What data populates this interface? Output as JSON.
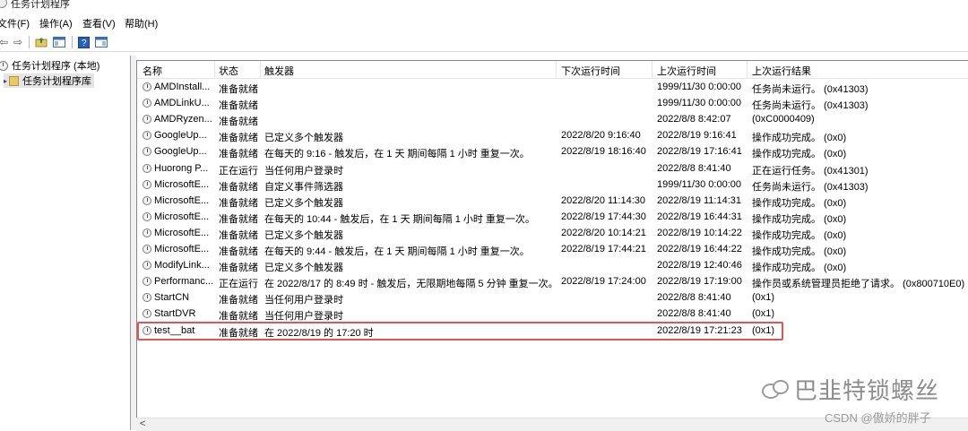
{
  "window": {
    "title": "任务计划程序"
  },
  "menu": [
    "文件(F)",
    "操作(A)",
    "查看(V)",
    "帮助(H)"
  ],
  "toolbar": {
    "buttons": [
      "back-icon",
      "forward-icon",
      "up-folder-icon",
      "show-hide-console-tree-icon",
      "help-icon",
      "show-hide-action-pane-icon"
    ]
  },
  "tree": {
    "root": "任务计划程序 (本地)",
    "library": "任务计划程序库"
  },
  "table": {
    "columns": [
      "名称",
      "状态",
      "触发器",
      "下次运行时间",
      "上次运行时间",
      "上次运行结果"
    ],
    "rows": [
      [
        "AMDInstall...",
        "准备就绪",
        "",
        "",
        "1999/11/30 0:00:00",
        "任务尚未运行。 (0x41303)"
      ],
      [
        "AMDLinkU...",
        "准备就绪",
        "",
        "",
        "1999/11/30 0:00:00",
        "任务尚未运行。 (0x41303)"
      ],
      [
        "AMDRyzen...",
        "准备就绪",
        "",
        "",
        "2022/8/8 8:42:07",
        "(0xC0000409)"
      ],
      [
        "GoogleUp...",
        "准备就绪",
        "已定义多个触发器",
        "2022/8/20 9:16:40",
        "2022/8/19 9:16:41",
        "操作成功完成。 (0x0)"
      ],
      [
        "GoogleUp...",
        "准备就绪",
        "在每天的 9:16 - 触发后，在 1 天 期间每隔 1 小时 重复一次。",
        "2022/8/19 18:16:40",
        "2022/8/19 17:16:41",
        "操作成功完成。 (0x0)"
      ],
      [
        "Huorong P...",
        "正在运行",
        "当任何用户登录时",
        "",
        "2022/8/8 8:41:40",
        "正在运行任务。 (0x41301)"
      ],
      [
        "MicrosoftE...",
        "准备就绪",
        "自定义事件筛选器",
        "",
        "1999/11/30 0:00:00",
        "任务尚未运行。 (0x41303)"
      ],
      [
        "MicrosoftE...",
        "准备就绪",
        "已定义多个触发器",
        "2022/8/20 11:14:30",
        "2022/8/19 11:14:31",
        "操作成功完成。 (0x0)"
      ],
      [
        "MicrosoftE...",
        "准备就绪",
        "在每天的 10:44 - 触发后，在 1 天 期间每隔 1 小时 重复一次。",
        "2022/8/19 17:44:30",
        "2022/8/19 16:44:31",
        "操作成功完成。 (0x0)"
      ],
      [
        "MicrosoftE...",
        "准备就绪",
        "已定义多个触发器",
        "2022/8/20 10:14:21",
        "2022/8/19 10:14:22",
        "操作成功完成。 (0x0)"
      ],
      [
        "MicrosoftE...",
        "准备就绪",
        "在每天的 9:44 - 触发后，在 1 天 期间每隔 1 小时 重复一次。",
        "2022/8/19 17:44:21",
        "2022/8/19 16:44:22",
        "操作成功完成。 (0x0)"
      ],
      [
        "ModifyLink...",
        "准备就绪",
        "已定义多个触发器",
        "",
        "2022/8/19 12:40:46",
        "操作成功完成。 (0x0)"
      ],
      [
        "Performanc...",
        "正在运行",
        "在 2022/8/17 的 8:49 时 - 触发后，无限期地每隔 5 分钟 重复一次。",
        "2022/8/19 17:24:00",
        "2022/8/19 17:19:00",
        "操作员或系统管理员拒绝了请求。 (0x800710E0)"
      ],
      [
        "StartCN",
        "准备就绪",
        "当任何用户登录时",
        "",
        "2022/8/8 8:41:40",
        "(0x1)"
      ],
      [
        "StartDVR",
        "准备就绪",
        "当任何用户登录时",
        "",
        "2022/8/8 8:41:40",
        "(0x1)"
      ],
      [
        "test__bat",
        "准备就绪",
        "在 2022/8/19 的 17:20 时",
        "",
        "2022/8/19 17:21:23",
        "(0x1)"
      ]
    ]
  },
  "watermark": {
    "text": "巴韭特锁螺丝",
    "csdn": "CSDN @傲娇的胖子"
  },
  "colors": {
    "highlight": "#e05555"
  }
}
